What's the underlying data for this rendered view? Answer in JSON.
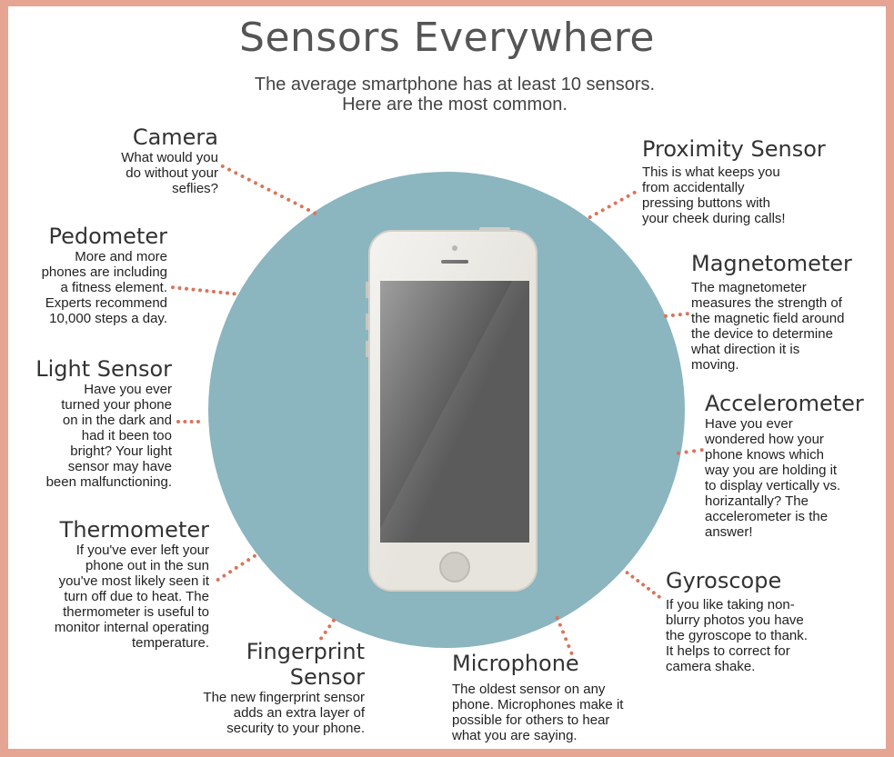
{
  "title": "Sensors Everywhere",
  "subtitle": "The average smartphone has at least 10 sensors.\nHere are the most common.",
  "colors": {
    "border": "#e6a493",
    "circle": "#8bb5bf",
    "dots": "#d9755a",
    "title": "#555555"
  },
  "phone": {
    "icon": "smartphone-icon"
  },
  "sensors": {
    "camera": {
      "name": "Camera",
      "desc": "What would you\ndo without your\nseflies?"
    },
    "pedometer": {
      "name": "Pedometer",
      "desc": "More and more\nphones are including\na fitness element.\nExperts recommend\n10,000 steps a day."
    },
    "light": {
      "name": "Light Sensor",
      "desc": "Have you ever\nturned your phone\non in the dark and\nhad it been too\nbright? Your light\nsensor may have\nbeen malfunctioning."
    },
    "thermometer": {
      "name": "Thermometer",
      "desc": "If you've ever left your\nphone out in the sun\nyou've most likely seen it\nturn off due to heat.  The\nthermometer is useful to\nmonitor internal operating\ntemperature."
    },
    "fingerprint": {
      "name": "Fingerprint\nSensor",
      "desc": "The new fingerprint sensor\nadds an extra layer of\nsecurity to your phone."
    },
    "microphone": {
      "name": "Microphone",
      "desc": "The oldest sensor on any\nphone. Microphones make it\npossible for others to hear\nwhat you are saying."
    },
    "gyroscope": {
      "name": "Gyroscope",
      "desc": "If you like taking non-\nblurry photos you have\nthe gyroscope to thank.\nIt helps to correct for\ncamera shake."
    },
    "accelerometer": {
      "name": "Accelerometer",
      "desc": "Have you ever\nwondered how your\nphone knows which\nway you are holding it\nto display vertically vs.\nhorizantally? The\naccelerometer is the\nanswer!"
    },
    "magnetometer": {
      "name": "Magnetometer",
      "desc": "The magnetometer\nmeasures the strength of\nthe magnetic field around\nthe device to determine\nwhat direction it is\nmoving."
    },
    "proximity": {
      "name": "Proximity Sensor",
      "desc": "This is what keeps you\nfrom accidentally\npressing buttons with\nyour cheek during calls!"
    }
  }
}
